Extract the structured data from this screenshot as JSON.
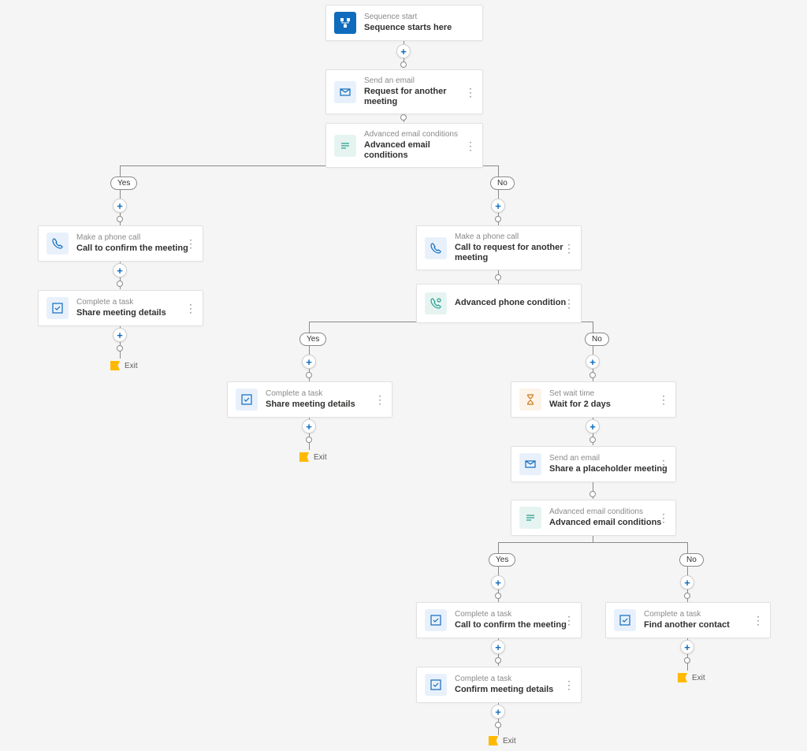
{
  "nodes": {
    "start": {
      "type": "Sequence start",
      "title": "Sequence starts here"
    },
    "email1": {
      "type": "Send an email",
      "title": "Request for another meeting"
    },
    "cond1": {
      "type": "Advanced email conditions",
      "title": "Advanced email conditions"
    },
    "phone_yes": {
      "type": "Make a phone call",
      "title": "Call to confirm the meeting"
    },
    "task_share1": {
      "type": "Complete a task",
      "title": "Share meeting details"
    },
    "phone_no": {
      "type": "Make a phone call",
      "title": "Call to request for another meeting"
    },
    "cond2": {
      "type": "",
      "title": "Advanced phone condition"
    },
    "task_share2": {
      "type": "Complete a task",
      "title": "Share meeting details"
    },
    "wait": {
      "type": "Set wait time",
      "title": "Wait for 2 days"
    },
    "email2": {
      "type": "Send an email",
      "title": "Share a placeholder meeting"
    },
    "cond3": {
      "type": "Advanced email conditions",
      "title": "Advanced email conditions"
    },
    "task_confirm_call": {
      "type": "Complete a task",
      "title": "Call to confirm the meeting"
    },
    "task_confirm_details": {
      "type": "Complete a task",
      "title": "Confirm meeting details"
    },
    "task_find": {
      "type": "Complete a task",
      "title": "Find another contact"
    }
  },
  "pills": {
    "yes": "Yes",
    "no": "No"
  },
  "exit_label": "Exit"
}
